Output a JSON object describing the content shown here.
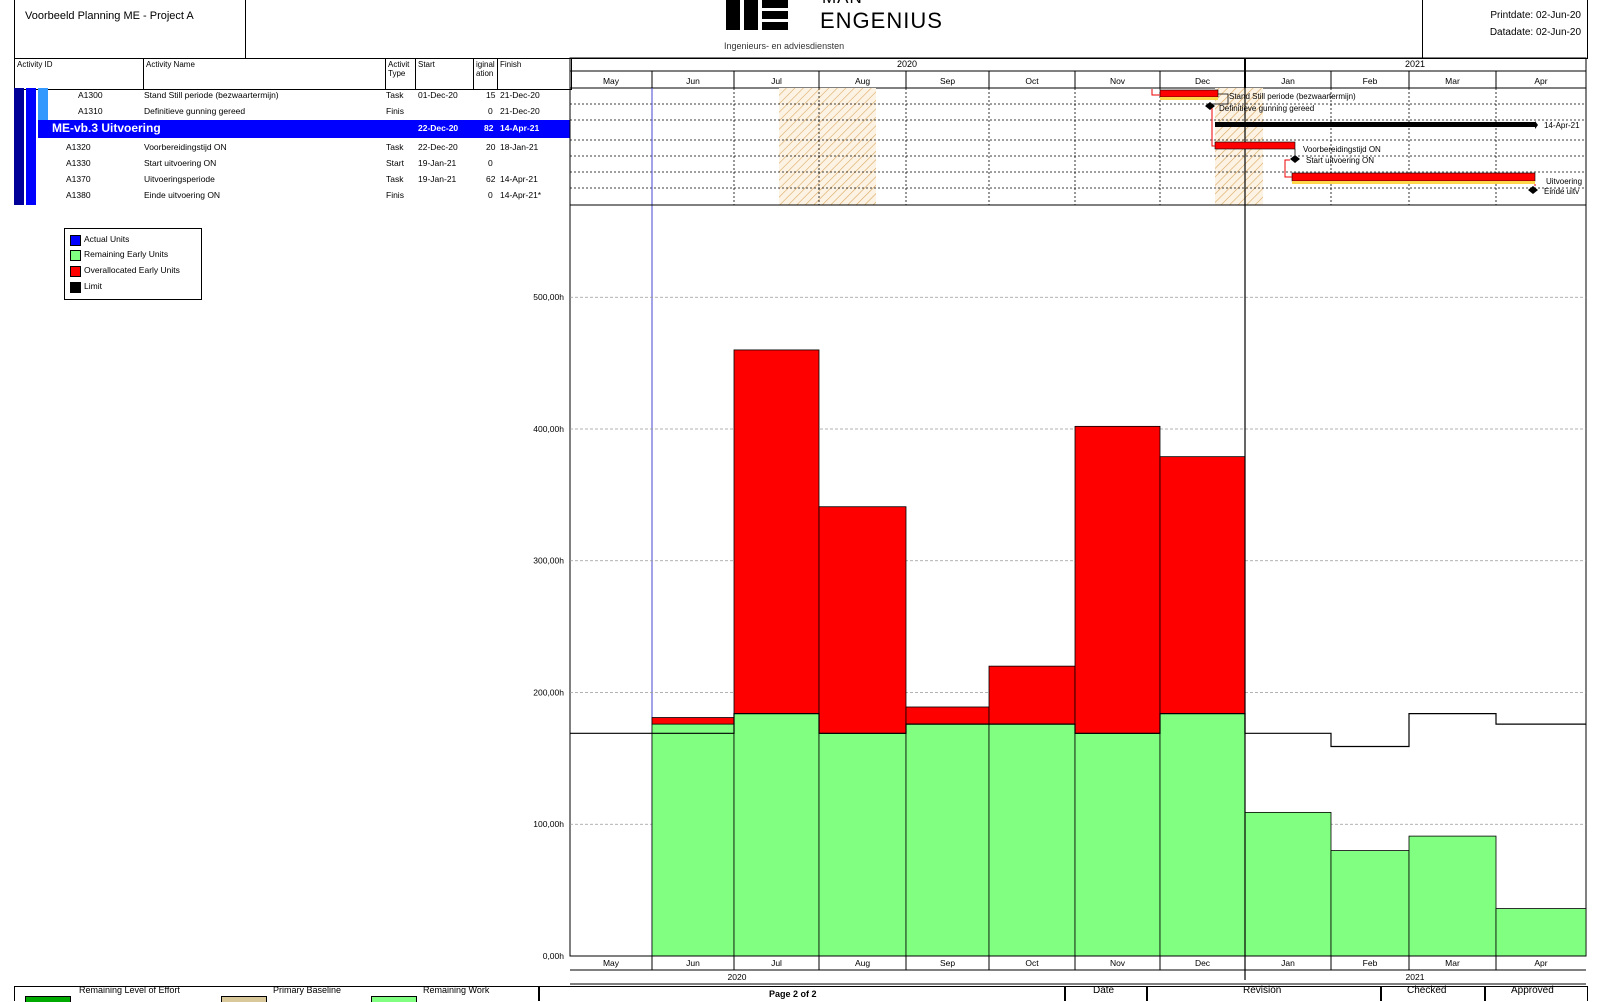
{
  "header": {
    "project_title": "Voorbeeld Planning ME - Project A",
    "logo_top": "MAN",
    "logo_brand": "ENGENIUS",
    "logo_tagline": "Ingenieurs- en adviesdiensten",
    "printdate": "Printdate: 02-Jun-20",
    "datadate": "Datadate: 02-Jun-20"
  },
  "table": {
    "columns": {
      "activity_id": "Activity ID",
      "activity_name": "Activity Name",
      "activity_type": "Activit Type",
      "start": "Start",
      "duration": "iginal ation",
      "finish": "Finish"
    },
    "rows": [
      {
        "id": "A1300",
        "name": "Stand Still periode (bezwaartermijn)",
        "type": "Task",
        "start": "01-Dec-20",
        "dur": "15",
        "finish": "21-Dec-20"
      },
      {
        "id": "A1310",
        "name": "Definitieve gunning gereed",
        "type": "Finis",
        "start": "",
        "dur": "0",
        "finish": "21-Dec-20"
      },
      {
        "id": "A1320",
        "name": "Voorbereidingstijd ON",
        "type": "Task",
        "start": "22-Dec-20",
        "dur": "20",
        "finish": "18-Jan-21"
      },
      {
        "id": "A1330",
        "name": "Start uitvoering ON",
        "type": "Start",
        "start": "19-Jan-21",
        "dur": "0",
        "finish": ""
      },
      {
        "id": "A1370",
        "name": "Uitvoeringsperiode",
        "type": "Task",
        "start": "19-Jan-21",
        "dur": "62",
        "finish": "14-Apr-21"
      },
      {
        "id": "A1380",
        "name": "Einde uitvoering ON",
        "type": "Finis",
        "start": "",
        "dur": "0",
        "finish": "14-Apr-21*"
      }
    ],
    "wbs": {
      "name": "ME-vb.3  Uitvoering",
      "start": "22-Dec-20",
      "dur": "82",
      "finish": "14-Apr-21"
    }
  },
  "timeline": {
    "years": [
      "2020",
      "2021"
    ],
    "months": [
      "May",
      "Jun",
      "Jul",
      "Aug",
      "Sep",
      "Oct",
      "Nov",
      "Dec",
      "Jan",
      "Feb",
      "Mar",
      "Apr"
    ],
    "bar_labels": [
      "Stand Still periode (bezwaartermijn)",
      "Definitieve gunning gereed",
      "14-Apr-21",
      "Voorbereidingstijd ON",
      "Start uitvoering ON",
      "Uitvoering",
      "Einde uitv"
    ]
  },
  "legend": [
    {
      "label": "Actual Units",
      "color": "#0000ff"
    },
    {
      "label": "Remaining Early Units",
      "color": "#80ff80"
    },
    {
      "label": "Overallocated Early Units",
      "color": "#ff0000"
    },
    {
      "label": "Limit",
      "color": "#000000"
    }
  ],
  "chart_data": {
    "type": "bar",
    "categories": [
      "May",
      "Jun",
      "Jul",
      "Aug",
      "Sep",
      "Oct",
      "Nov",
      "Dec",
      "Jan",
      "Feb",
      "Mar",
      "Apr"
    ],
    "y_tick_labels": [
      "0,00h",
      "100,00h",
      "200,00h",
      "300,00h",
      "400,00h",
      "500,00h"
    ],
    "ylim": [
      0,
      570
    ],
    "series": [
      {
        "name": "Remaining Early Units",
        "values": [
          0,
          176,
          184,
          169,
          176,
          176,
          169,
          184,
          109,
          80,
          91,
          36
        ],
        "color": "#80ff80"
      },
      {
        "name": "Overallocated Early Units",
        "values": [
          0,
          5,
          276,
          172,
          13,
          44,
          233,
          195,
          0,
          0,
          0,
          0
        ],
        "color": "#ff0000"
      },
      {
        "name": "Limit",
        "values": [
          169,
          169,
          184,
          169,
          176,
          176,
          169,
          184,
          169,
          159,
          184,
          176
        ],
        "color": "#000000"
      }
    ],
    "x_years": [
      "2020",
      "2021"
    ]
  },
  "footer": {
    "legend_items": [
      "Remaining Level of Effort",
      "Primary Baseline",
      "Remaining Work"
    ],
    "page": "Page 2 of 2",
    "cols": [
      "Date",
      "Revision",
      "Checked",
      "Approved"
    ]
  }
}
